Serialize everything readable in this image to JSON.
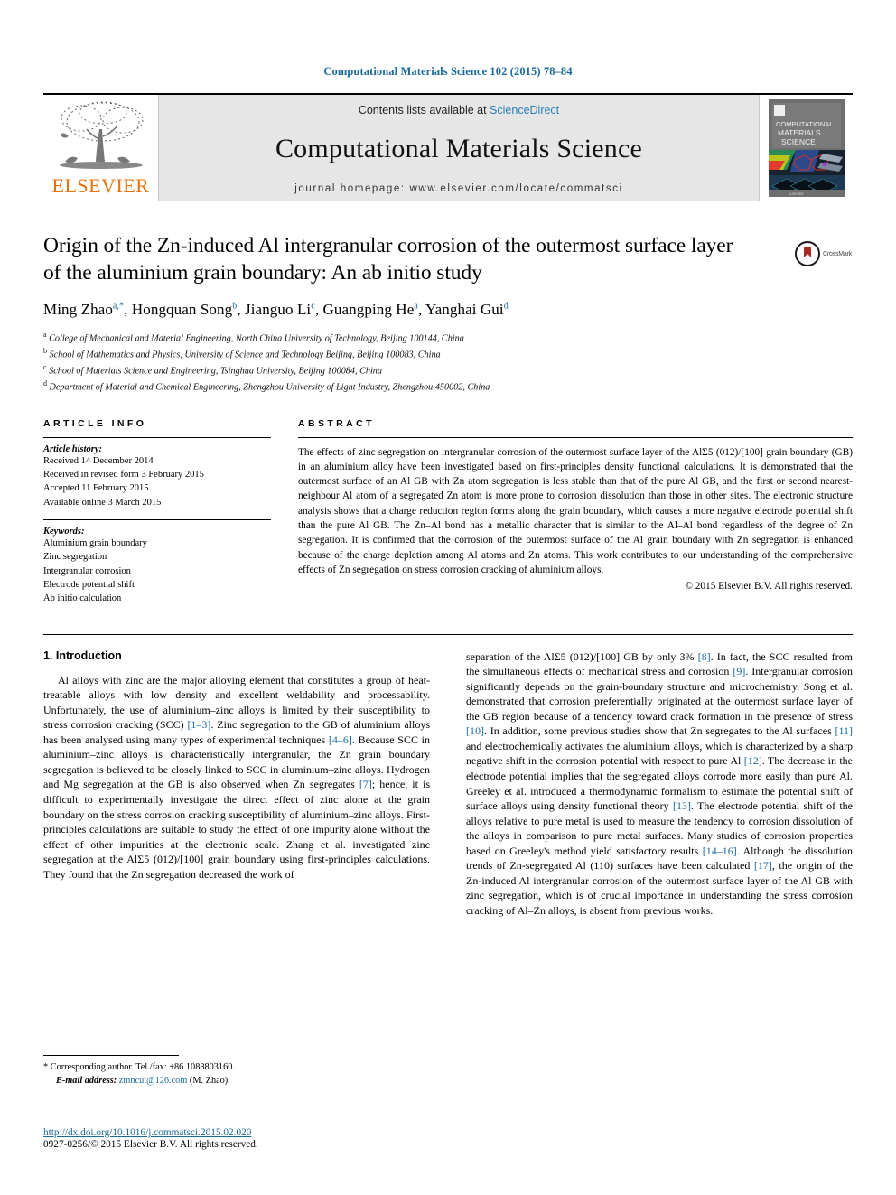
{
  "running_head": "Computational Materials Science 102 (2015) 78–84",
  "masthead": {
    "publisher_name": "ELSEVIER",
    "contents_prefix": "Contents lists available at ",
    "sciencedirect": "ScienceDirect",
    "journal_title": "Computational Materials Science",
    "homepage": "journal homepage: www.elsevier.com/locate/commatsci",
    "cover_line1": "COMPUTATIONAL",
    "cover_line2": "MATERIALS",
    "cover_line3": "SCIENCE"
  },
  "article": {
    "title": "Origin of the Zn-induced Al intergranular corrosion of the outermost surface layer of the aluminium grain boundary: An ab initio study",
    "crossmark_label": "CrossMark",
    "authors": [
      {
        "name": "Ming Zhao",
        "marks": "a,*"
      },
      {
        "name": "Hongquan Song",
        "marks": "b"
      },
      {
        "name": "Jianguo Li",
        "marks": "c"
      },
      {
        "name": "Guangping He",
        "marks": "a"
      },
      {
        "name": "Yanghai Gui",
        "marks": "d"
      }
    ],
    "affiliations": [
      {
        "mark": "a",
        "text": "College of Mechanical and Material Engineering, North China University of Technology, Beijing 100144, China"
      },
      {
        "mark": "b",
        "text": "School of Mathematics and Physics, University of Science and Technology Beijing, Beijing 100083, China"
      },
      {
        "mark": "c",
        "text": "School of Materials Science and Engineering, Tsinghua University, Beijing 100084, China"
      },
      {
        "mark": "d",
        "text": "Department of Material and Chemical Engineering, Zhengzhou University of Light Industry, Zhengzhou 450002, China"
      }
    ]
  },
  "article_info": {
    "heading": "ARTICLE INFO",
    "history_label": "Article history:",
    "history": [
      "Received 14 December 2014",
      "Received in revised form 3 February 2015",
      "Accepted 11 February 2015",
      "Available online 3 March 2015"
    ],
    "keywords_label": "Keywords:",
    "keywords": [
      "Aluminium grain boundary",
      "Zinc segregation",
      "Intergranular corrosion",
      "Electrode potential shift",
      "Ab initio calculation"
    ]
  },
  "abstract": {
    "heading": "ABSTRACT",
    "text": "The effects of zinc segregation on intergranular corrosion of the outermost surface layer of the AlΣ5 (012)/[100] grain boundary (GB) in an aluminium alloy have been investigated based on first-principles density functional calculations. It is demonstrated that the outermost surface of an Al GB with Zn atom segregation is less stable than that of the pure Al GB, and the first or second nearest-neighbour Al atom of a segregated Zn atom is more prone to corrosion dissolution than those in other sites. The electronic structure analysis shows that a charge reduction region forms along the grain boundary, which causes a more negative electrode potential shift than the pure Al GB. The Zn–Al bond has a metallic character that is similar to the Al–Al bond regardless of the degree of Zn segregation. It is confirmed that the corrosion of the outermost surface of the Al grain boundary with Zn segregation is enhanced because of the charge depletion among Al atoms and Zn atoms. This work contributes to our understanding of the comprehensive effects of Zn segregation on stress corrosion cracking of aluminium alloys.",
    "copyright": "© 2015 Elsevier B.V. All rights reserved."
  },
  "introduction": {
    "heading": "1. Introduction",
    "left_paragraph_parts": [
      {
        "t": "Al alloys with zinc are the major alloying element that constitutes a group of heat-treatable alloys with low density and excellent weldability and processability. Unfortunately, the use of aluminium–zinc alloys is limited by their susceptibility to stress corrosion cracking (SCC) "
      },
      {
        "t": "[1–3]",
        "ref": true
      },
      {
        "t": ". Zinc segregation to the GB of aluminium alloys has been analysed using many types of experimental techniques "
      },
      {
        "t": "[4–6]",
        "ref": true
      },
      {
        "t": ". Because SCC in aluminium–zinc alloys is characteristically intergranular, the Zn grain boundary segregation is believed to be closely linked to SCC in aluminium–zinc alloys. Hydrogen and Mg segregation at the GB is also observed when Zn segregates "
      },
      {
        "t": "[7]",
        "ref": true
      },
      {
        "t": "; hence, it is difficult to experimentally investigate the direct effect of zinc alone at the grain boundary on the stress corrosion cracking susceptibility of aluminium–zinc alloys. First-principles calculations are suitable to study the effect of one impurity alone without the effect of other impurities at the electronic scale. Zhang et al. investigated zinc segregation at the AlΣ5 (012)/[100] grain boundary using first-principles calculations. They found that the Zn segregation decreased the work of"
      }
    ],
    "right_paragraph_parts": [
      {
        "t": "separation of the AlΣ5 (012)/[100] GB by only 3% "
      },
      {
        "t": "[8]",
        "ref": true
      },
      {
        "t": ". In fact, the SCC resulted from the simultaneous effects of mechanical stress and corrosion "
      },
      {
        "t": "[9]",
        "ref": true
      },
      {
        "t": ". Intergranular corrosion significantly depends on the grain-boundary structure and microchemistry. Song et al. demonstrated that corrosion preferentially originated at the outermost surface layer of the GB region because of a tendency toward crack formation in the presence of stress "
      },
      {
        "t": "[10]",
        "ref": true
      },
      {
        "t": ". In addition, some previous studies show that Zn segregates to the Al surfaces "
      },
      {
        "t": "[11]",
        "ref": true
      },
      {
        "t": " and electrochemically activates the aluminium alloys, which is characterized by a sharp negative shift in the corrosion potential with respect to pure Al "
      },
      {
        "t": "[12]",
        "ref": true
      },
      {
        "t": ". The decrease in the electrode potential implies that the segregated alloys corrode more easily than pure Al. Greeley et al. introduced a thermodynamic formalism to estimate the potential shift of surface alloys using density functional theory "
      },
      {
        "t": "[13]",
        "ref": true
      },
      {
        "t": ". The electrode potential shift of the alloys relative to pure metal is used to measure the tendency to corrosion dissolution of the alloys in comparison to pure metal surfaces. Many studies of corrosion properties based on Greeley's method yield satisfactory results "
      },
      {
        "t": "[14–16]",
        "ref": true
      },
      {
        "t": ". Although the dissolution trends of Zn-segregated Al (110) surfaces have been calculated "
      },
      {
        "t": "[17]",
        "ref": true
      },
      {
        "t": ", the origin of the Zn-induced Al intergranular corrosion of the outermost surface layer of the Al GB with zinc segregation, which is of crucial importance in understanding the stress corrosion cracking of Al–Zn alloys, is absent from previous works."
      }
    ]
  },
  "footnote": {
    "corresponding": "* Corresponding author. Tel./fax: +86 1088803160.",
    "email_label": "E-mail address:",
    "email": "zmncut@126.com",
    "email_suffix": "(M. Zhao)."
  },
  "footer": {
    "doi": "http://dx.doi.org/10.1016/j.commatsci.2015.02.020",
    "issn": "0927-0256/© 2015 Elsevier B.V. All rights reserved."
  },
  "colors": {
    "link": "#1b6a9c",
    "elsevier_orange": "#E8710A",
    "band_grey": "#e6e6e6"
  }
}
